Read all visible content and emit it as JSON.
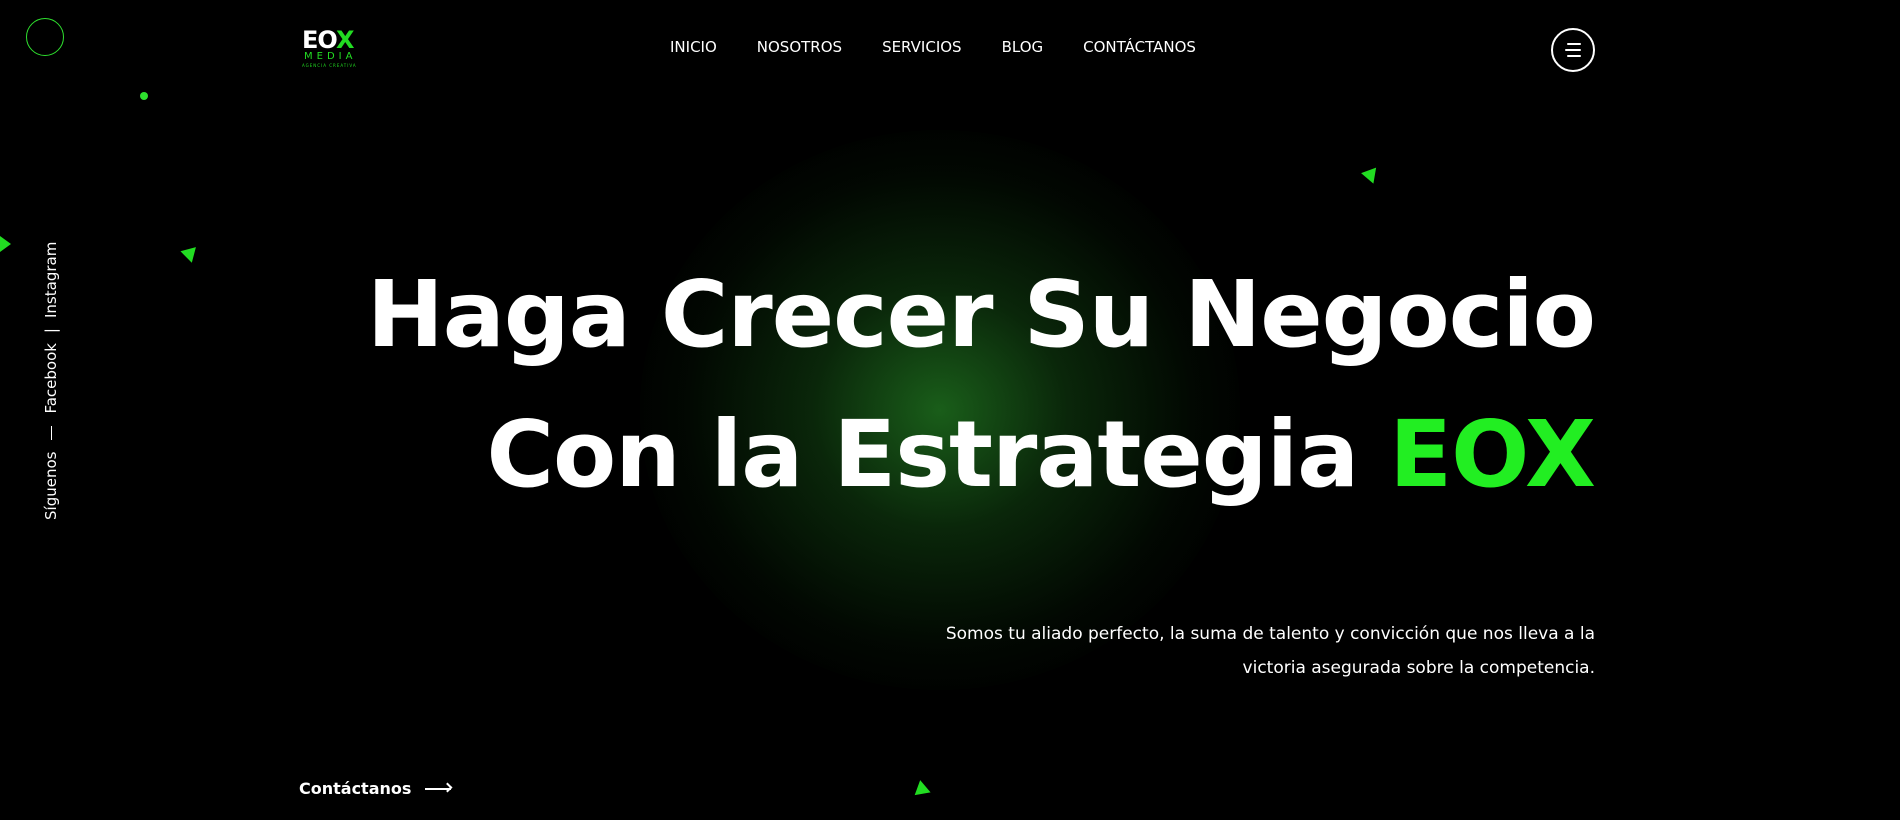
{
  "brand": {
    "logo_main_prefix": "EO",
    "logo_main_accent": "X",
    "logo_sub": "MEDIA",
    "logo_tagline": "AGENCIA CREATIVA",
    "accent_color": "#22ee22"
  },
  "nav": {
    "items": [
      {
        "label": "INICIO"
      },
      {
        "label": "NOSOTROS"
      },
      {
        "label": "SERVICIOS"
      },
      {
        "label": "BLOG"
      },
      {
        "label": "CONTÁCTANOS"
      }
    ],
    "menu_icon": "hamburger-menu-icon"
  },
  "social": {
    "label": "Síguenos",
    "links": [
      {
        "label": "Facebook"
      },
      {
        "label": "Instagram"
      }
    ],
    "separator": "|"
  },
  "hero": {
    "headline_line1": "Haga Crecer Su Negocio",
    "headline_line2_prefix": "Con la Estrategia",
    "headline_line2_accent": "EOX",
    "subtext": "Somos tu aliado perfecto, la suma de talento y convicción que nos lleva a la victoria asegurada sobre la competencia.",
    "cta_label": "Contáctanos",
    "cta_icon": "arrow-right-icon"
  }
}
